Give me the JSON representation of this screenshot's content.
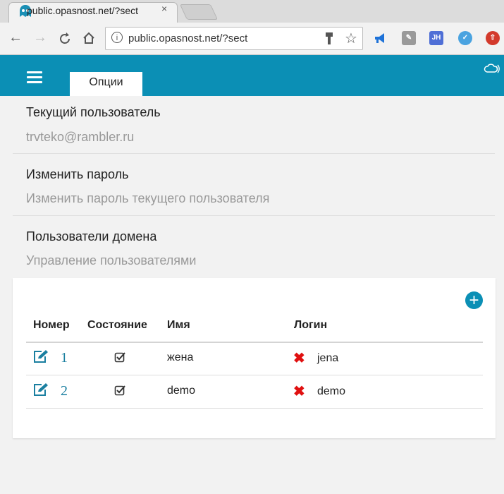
{
  "browser": {
    "tab_title": "public.opasnost.net/?sect",
    "tab_close": "×",
    "url": "public.opasnost.net/?sect"
  },
  "app": {
    "options_tab": "Опции"
  },
  "sections": [
    {
      "title": "Текущий пользователь",
      "subtitle": "trvteko@rambler.ru"
    },
    {
      "title": "Изменить пароль",
      "subtitle": "Изменить пароль текущего пользователя"
    },
    {
      "title": "Пользователи домена",
      "subtitle": "Управление пользователями"
    }
  ],
  "table": {
    "headers": {
      "number": "Номер",
      "state": "Состояние",
      "name": "Имя",
      "login": "Логин"
    },
    "rows": [
      {
        "number": "1",
        "name": "жена",
        "login": "jena"
      },
      {
        "number": "2",
        "name": "demo",
        "login": "demo"
      }
    ]
  },
  "colors": {
    "accent": "#0b8fb5",
    "delete": "#e01010"
  }
}
